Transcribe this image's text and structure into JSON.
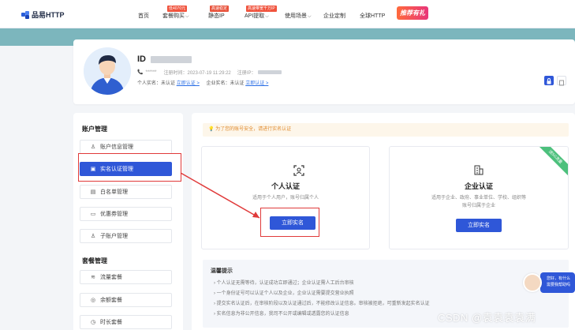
{
  "nav": {
    "logo": "品易HTTP",
    "items": [
      {
        "label": "首页",
        "tag": ""
      },
      {
        "label": "套餐购买",
        "tag": "低4070元",
        "dropdown": true
      },
      {
        "label": "静态IP",
        "tag": "高速稳定",
        "dropdown": false
      },
      {
        "label": "API提取",
        "tag": "高速带宽千万IP",
        "dropdown": true
      },
      {
        "label": "使用场景",
        "tag": "",
        "dropdown": true
      },
      {
        "label": "企业定制",
        "tag": ""
      },
      {
        "label": "全球HTTP",
        "tag": ""
      }
    ],
    "promo": "推荐有礼"
  },
  "profile": {
    "id_label": "ID",
    "phone": "******",
    "register_label": "注册时间：2023-07-19 11:29:22",
    "register_ip_label": "注册IP：",
    "personal_label": "个人实名：未认证",
    "personal_link": "立即认证 >",
    "company_label": "企业实名：未认证",
    "company_link": "立即认证 >"
  },
  "sidebar": {
    "account_heading": "账户管理",
    "account_items": [
      "账户信息管理",
      "实名认证管理",
      "白名单管理",
      "优惠券管理",
      "子账户管理"
    ],
    "package_heading": "套餐管理",
    "package_items": [
      "流量套餐",
      "余额套餐",
      "时长套餐"
    ]
  },
  "main": {
    "tip": "为了您的账号安全，请进行实名认证",
    "personal_card": {
      "title": "个人认证",
      "desc": "适用于个人用户，账号归属个人",
      "button": "立即实名"
    },
    "company_card": {
      "title": "企业认证",
      "desc_line1": "适用于企业、政府、事业单位、学校、组织等",
      "desc_line2": "账号归属于企业",
      "button": "立即实名",
      "ribbon": "送5G流量"
    },
    "notes": {
      "title": "温馨提示",
      "lines": [
        "个人认证无需等待，认证成功立即通过；企业认证需人工后台审核",
        "一个身份证号可以认证个人以及企业，企业认证需要提交营业执照",
        "提交实名认证后，在审核阶段以及认证通过后，不能修改认证信息。审核被拒绝，可重新发起实名认证",
        "实名信息为非公开信息，我司不公开或编辑或透露您的认证信息"
      ]
    }
  },
  "support": {
    "line1": "您好，有什么",
    "line2": "需要我帮助吗"
  },
  "watermark": "CSDN @袁袁袁袁满",
  "colors": {
    "accent": "#2f57d8",
    "highlight_box": "#e03a3a",
    "band": "#7cb6bd"
  }
}
